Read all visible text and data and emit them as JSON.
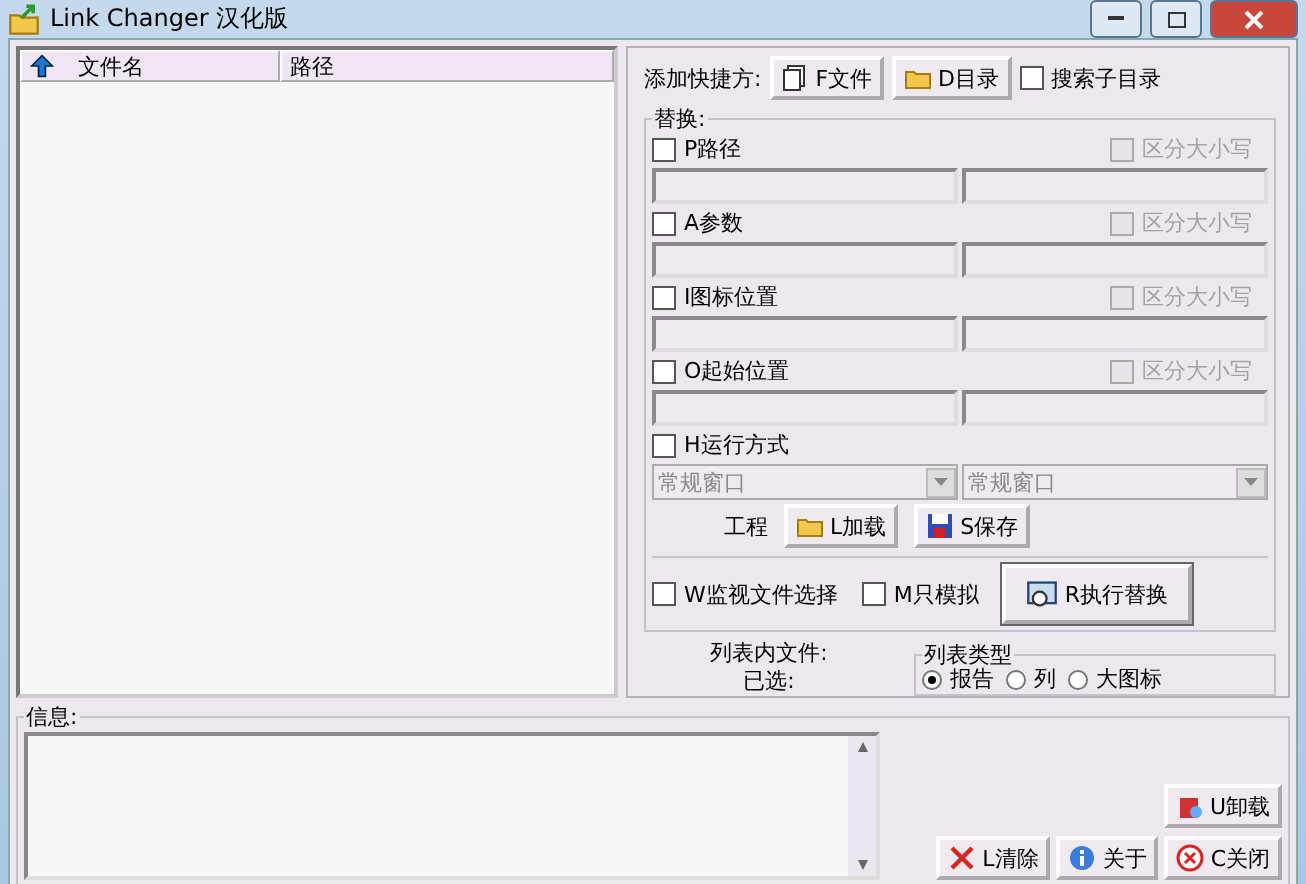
{
  "window": {
    "title": "Link Changer 汉化版"
  },
  "file_list": {
    "columns": [
      {
        "label": "文件名",
        "sorted": true
      },
      {
        "label": "路径",
        "sorted": false
      }
    ]
  },
  "add_shortcut": {
    "label": "添加快捷方:",
    "buttons": [
      {
        "label": "F文件",
        "kind": "file"
      },
      {
        "label": "D目录",
        "kind": "folder"
      }
    ],
    "search_subdirs": {
      "label": "搜索子目录",
      "checked": false
    }
  },
  "replace": {
    "title": "替换:",
    "fields": [
      {
        "label": "P路径",
        "checked": false,
        "case": {
          "label": "区分大小写",
          "checked": false,
          "disabled": true
        }
      },
      {
        "label": "A参数",
        "checked": false,
        "case": {
          "label": "区分大小写",
          "checked": false,
          "disabled": true
        }
      },
      {
        "label": "I图标位置",
        "checked": false,
        "case": {
          "label": "区分大小写",
          "checked": false,
          "disabled": true
        }
      },
      {
        "label": "O起始位置",
        "checked": false,
        "case": {
          "label": "区分大小写",
          "checked": false,
          "disabled": true
        }
      }
    ],
    "run_mode": {
      "label": "H运行方式",
      "checked": false,
      "selects": [
        {
          "value": "常规窗口",
          "disabled": true
        },
        {
          "value": "常规窗口",
          "disabled": true
        }
      ]
    },
    "project": {
      "label": "工程",
      "buttons": [
        {
          "label": "L加载",
          "kind": "open"
        },
        {
          "label": "S保存",
          "kind": "save"
        }
      ]
    },
    "options": [
      {
        "label": "W监视文件选择",
        "checked": false
      },
      {
        "label": "M只模拟",
        "checked": false
      }
    ],
    "execute": {
      "label": "R执行替换"
    }
  },
  "list_info": {
    "files": "列表内文件:",
    "selected": "已选:"
  },
  "list_type": {
    "title": "列表类型",
    "options": [
      {
        "label": "报告",
        "selected": true
      },
      {
        "label": "列",
        "selected": false
      },
      {
        "label": "大图标",
        "selected": false
      }
    ]
  },
  "info": {
    "title": "信息:",
    "buttons": [
      {
        "label": "U卸载",
        "kind": "uninstall"
      },
      {
        "label": "L清除",
        "kind": "clear"
      },
      {
        "label": "关于",
        "kind": "about"
      },
      {
        "label": "C关闭",
        "kind": "close"
      }
    ]
  }
}
